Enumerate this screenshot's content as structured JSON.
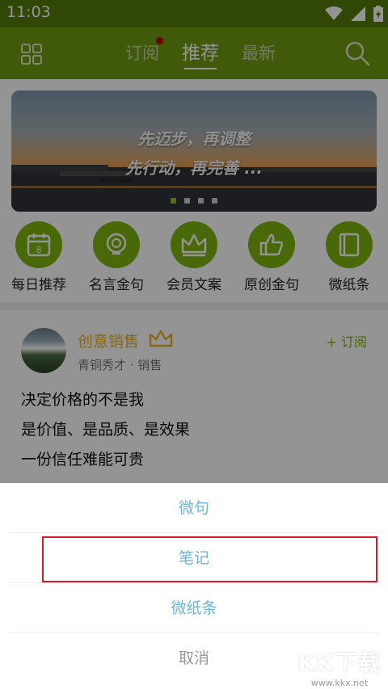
{
  "status_bar": {
    "time": "11:03"
  },
  "header": {
    "tabs": [
      {
        "label": "订阅"
      },
      {
        "label": "推荐"
      },
      {
        "label": "最新"
      }
    ]
  },
  "banner": {
    "line1": "先迈步，再调整",
    "line2": "先行动，再完善 ..."
  },
  "categories": [
    {
      "label": "每日推荐",
      "icon": "calendar-icon"
    },
    {
      "label": "名言金句",
      "icon": "lightbulb-icon"
    },
    {
      "label": "会员文案",
      "icon": "crown-icon"
    },
    {
      "label": "原创金句",
      "icon": "thumbs-up-icon"
    },
    {
      "label": "微纸条",
      "icon": "book-icon"
    }
  ],
  "calendar_day": "8",
  "post": {
    "author": "创意销售",
    "meta": "青铜秀才 · 销售",
    "subscribe": "+ 订阅",
    "lines": [
      "决定价格的不是我",
      "是价值、是品质、是效果",
      "一份信任难能可贵"
    ]
  },
  "sheet": {
    "items": [
      "微句",
      "笔记",
      "微纸条"
    ],
    "cancel": "取消"
  },
  "watermark": {
    "logo": "KK下载",
    "url": "www.kkx.net"
  },
  "colors": {
    "header": "#6f9b12",
    "accent": "#7fb40e",
    "sheet_text": "#6ab4d8",
    "highlight": "#d51b2b"
  }
}
